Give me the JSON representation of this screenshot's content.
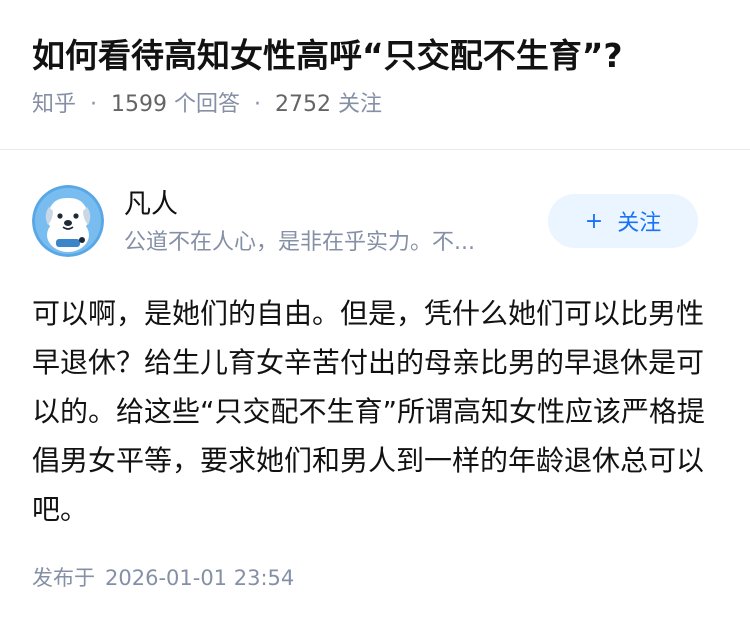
{
  "question": {
    "title": "如何看待高知女性高呼“只交配不生育”?",
    "source": "知乎",
    "answer_count": "1599",
    "answer_label": "个回答",
    "follow_count": "2752",
    "follow_label": "关注",
    "separator": "·"
  },
  "answer": {
    "author": {
      "name": "凡人",
      "bio": "公道不在人心，是非在乎实力。不...",
      "avatar_icon": "cartoon-dog-avatar-icon"
    },
    "follow_button": {
      "plus": "+",
      "label": "关注"
    },
    "content": "可以啊，是她们的自由。但是，凭什么她们可以比男性早退休？给生儿育女辛苦付出的母亲比男的早退休是可以的。给这些“只交配不生育”所谓高知女性应该严格提倡男女平等，要求她们和男人到一样的年龄退休总可以吧。",
    "publish_label": "发布于",
    "publish_time": "2026-01-01 23:54"
  },
  "colors": {
    "accent": "#1772f6",
    "accent_bg": "#ebf5ff",
    "muted_text": "#8590a6",
    "main_text": "#121212"
  }
}
